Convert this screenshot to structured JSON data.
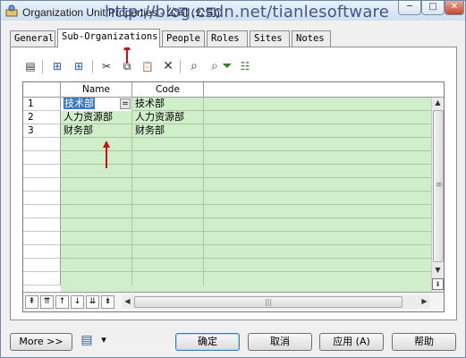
{
  "window": {
    "title": "Organization Unit Properties - 公司 (公司)",
    "watermark": "http://blog.csdn.net/tianlesoftware",
    "controls": {
      "minimize": "─",
      "maximize": "□",
      "close": "✕"
    }
  },
  "tabs": [
    {
      "label": "General",
      "active": false
    },
    {
      "label": "Sub-Organizations",
      "active": true
    },
    {
      "label": "People",
      "active": false
    },
    {
      "label": "Roles",
      "active": false
    },
    {
      "label": "Sites",
      "active": false
    },
    {
      "label": "Notes",
      "active": false
    }
  ],
  "toolbar": {
    "icons": [
      "properties-icon",
      "insert-row-icon",
      "add-row-icon",
      "cut-icon",
      "copy-icon",
      "paste-icon",
      "delete-icon",
      "find-icon",
      "find-next-icon",
      "filter-icon",
      "customize-columns-icon"
    ],
    "glyphs": {
      "properties": "▤",
      "insert_row": "⊞",
      "add_row": "⊞",
      "cut": "✂",
      "copy": "⧉",
      "paste": "📋",
      "delete": "✕",
      "find": "⌕",
      "find_next": "⌕",
      "filter": "⏷",
      "customize": "☷"
    }
  },
  "grid": {
    "columns": [
      "Name",
      "Code"
    ],
    "rows": [
      {
        "num": "1",
        "name": "技术部",
        "code": "技术部",
        "selected": true
      },
      {
        "num": "2",
        "name": "人力资源部",
        "code": "人力资源部",
        "selected": false
      },
      {
        "num": "3",
        "name": "财务部",
        "code": "财务部",
        "selected": false
      }
    ],
    "edit_button": "=",
    "hscroll_grip": "|||",
    "vscroll_grip": "≡",
    "nav": [
      "⇞",
      "⇈",
      "↑",
      "↓",
      "⇊",
      "⇟"
    ],
    "vscroll_arrows": {
      "up": "▲",
      "down": "▼",
      "more_down": "⇟"
    },
    "hscroll_arrows": {
      "left": "◀",
      "right": "▶"
    }
  },
  "colors": {
    "grid_bg": "#cfeec9",
    "selection": "#3a78c4",
    "annotation_arrow": "#d01010"
  },
  "buttons": {
    "more": "More >>",
    "layout_icon": "▤",
    "layout_dropdown": "▾",
    "ok": "确定",
    "cancel": "取消",
    "apply": "应用 (A)",
    "help": "帮助"
  }
}
